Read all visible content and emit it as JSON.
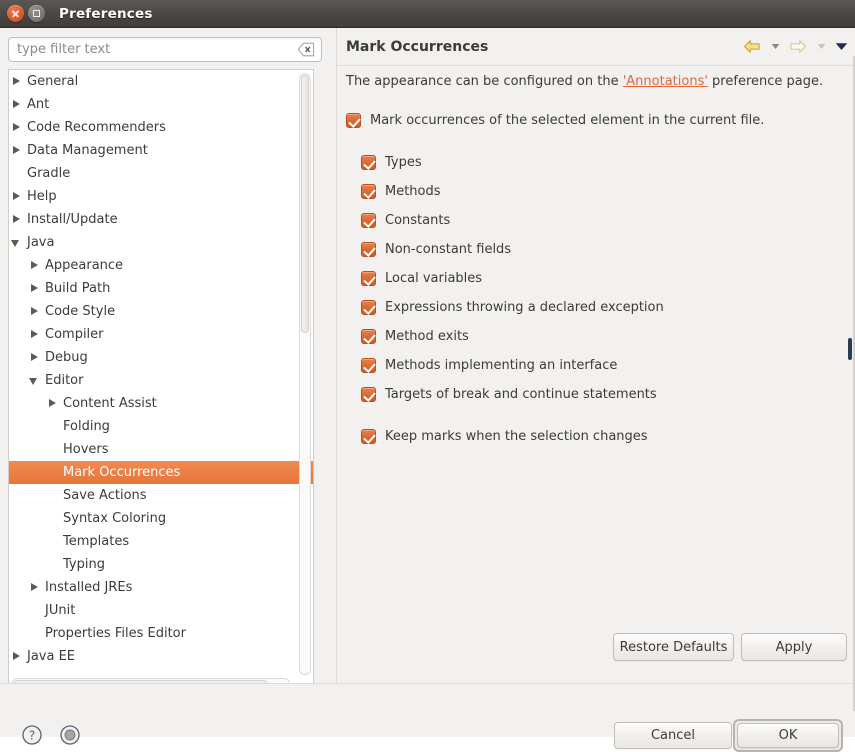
{
  "window": {
    "title": "Preferences",
    "close_icon": "close-icon",
    "maximize_icon": "maximize-icon"
  },
  "search": {
    "placeholder": "type filter text",
    "value": "",
    "clear_icon": "clear-icon"
  },
  "tree": {
    "items": [
      {
        "label": "General",
        "level": 0,
        "arrow": "closed",
        "selected": false
      },
      {
        "label": "Ant",
        "level": 0,
        "arrow": "closed",
        "selected": false
      },
      {
        "label": "Code Recommenders",
        "level": 0,
        "arrow": "closed",
        "selected": false
      },
      {
        "label": "Data Management",
        "level": 0,
        "arrow": "closed",
        "selected": false
      },
      {
        "label": "Gradle",
        "level": 0,
        "arrow": "none",
        "selected": false
      },
      {
        "label": "Help",
        "level": 0,
        "arrow": "closed",
        "selected": false
      },
      {
        "label": "Install/Update",
        "level": 0,
        "arrow": "closed",
        "selected": false
      },
      {
        "label": "Java",
        "level": 0,
        "arrow": "open",
        "selected": false
      },
      {
        "label": "Appearance",
        "level": 1,
        "arrow": "closed",
        "selected": false
      },
      {
        "label": "Build Path",
        "level": 1,
        "arrow": "closed",
        "selected": false
      },
      {
        "label": "Code Style",
        "level": 1,
        "arrow": "closed",
        "selected": false
      },
      {
        "label": "Compiler",
        "level": 1,
        "arrow": "closed",
        "selected": false
      },
      {
        "label": "Debug",
        "level": 1,
        "arrow": "closed",
        "selected": false
      },
      {
        "label": "Editor",
        "level": 1,
        "arrow": "open",
        "selected": false
      },
      {
        "label": "Content Assist",
        "level": 2,
        "arrow": "closed",
        "selected": false
      },
      {
        "label": "Folding",
        "level": 2,
        "arrow": "none",
        "selected": false
      },
      {
        "label": "Hovers",
        "level": 2,
        "arrow": "none",
        "selected": false
      },
      {
        "label": "Mark Occurrences",
        "level": 2,
        "arrow": "none",
        "selected": true
      },
      {
        "label": "Save Actions",
        "level": 2,
        "arrow": "none",
        "selected": false
      },
      {
        "label": "Syntax Coloring",
        "level": 2,
        "arrow": "none",
        "selected": false
      },
      {
        "label": "Templates",
        "level": 2,
        "arrow": "none",
        "selected": false
      },
      {
        "label": "Typing",
        "level": 2,
        "arrow": "none",
        "selected": false
      },
      {
        "label": "Installed JREs",
        "level": 1,
        "arrow": "closed",
        "selected": false
      },
      {
        "label": "JUnit",
        "level": 1,
        "arrow": "none",
        "selected": false
      },
      {
        "label": "Properties Files Editor",
        "level": 1,
        "arrow": "none",
        "selected": false
      },
      {
        "label": "Java EE",
        "level": 0,
        "arrow": "closed",
        "selected": false
      }
    ]
  },
  "page": {
    "title": "Mark Occurrences",
    "description_before": "The appearance can be configured on the ",
    "description_link": "'Annotations'",
    "description_after": " preference page.",
    "nav": {
      "back_icon": "back-arrow-icon",
      "back_dropdown_icon": "chevron-down-icon",
      "forward_icon": "forward-arrow-icon",
      "forward_dropdown_icon": "chevron-down-icon",
      "menu_icon": "chevron-down-icon"
    },
    "master_checkbox": {
      "label": "Mark occurrences of the selected element in the current file.",
      "checked": true
    },
    "options": [
      {
        "label": "Types",
        "checked": true
      },
      {
        "label": "Methods",
        "checked": true
      },
      {
        "label": "Constants",
        "checked": true
      },
      {
        "label": "Non-constant fields",
        "checked": true
      },
      {
        "label": "Local variables",
        "checked": true
      },
      {
        "label": "Expressions throwing a declared exception",
        "checked": true
      },
      {
        "label": "Method exits",
        "checked": true
      },
      {
        "label": "Methods implementing an interface",
        "checked": true
      },
      {
        "label": "Targets of break and continue statements",
        "checked": true
      }
    ],
    "keep_marks": {
      "label": "Keep marks when the selection changes",
      "checked": true
    },
    "restore_defaults_label": "Restore Defaults",
    "apply_label": "Apply"
  },
  "footer": {
    "help_icon": "help-icon",
    "disc_icon": "circle-icon",
    "cancel_label": "Cancel",
    "ok_label": "OK"
  },
  "colors": {
    "accent_orange": "#e8743b",
    "link_orange": "#e2673a",
    "titlebar": "#4b4845",
    "dialog_bg": "#f2f1f0"
  }
}
